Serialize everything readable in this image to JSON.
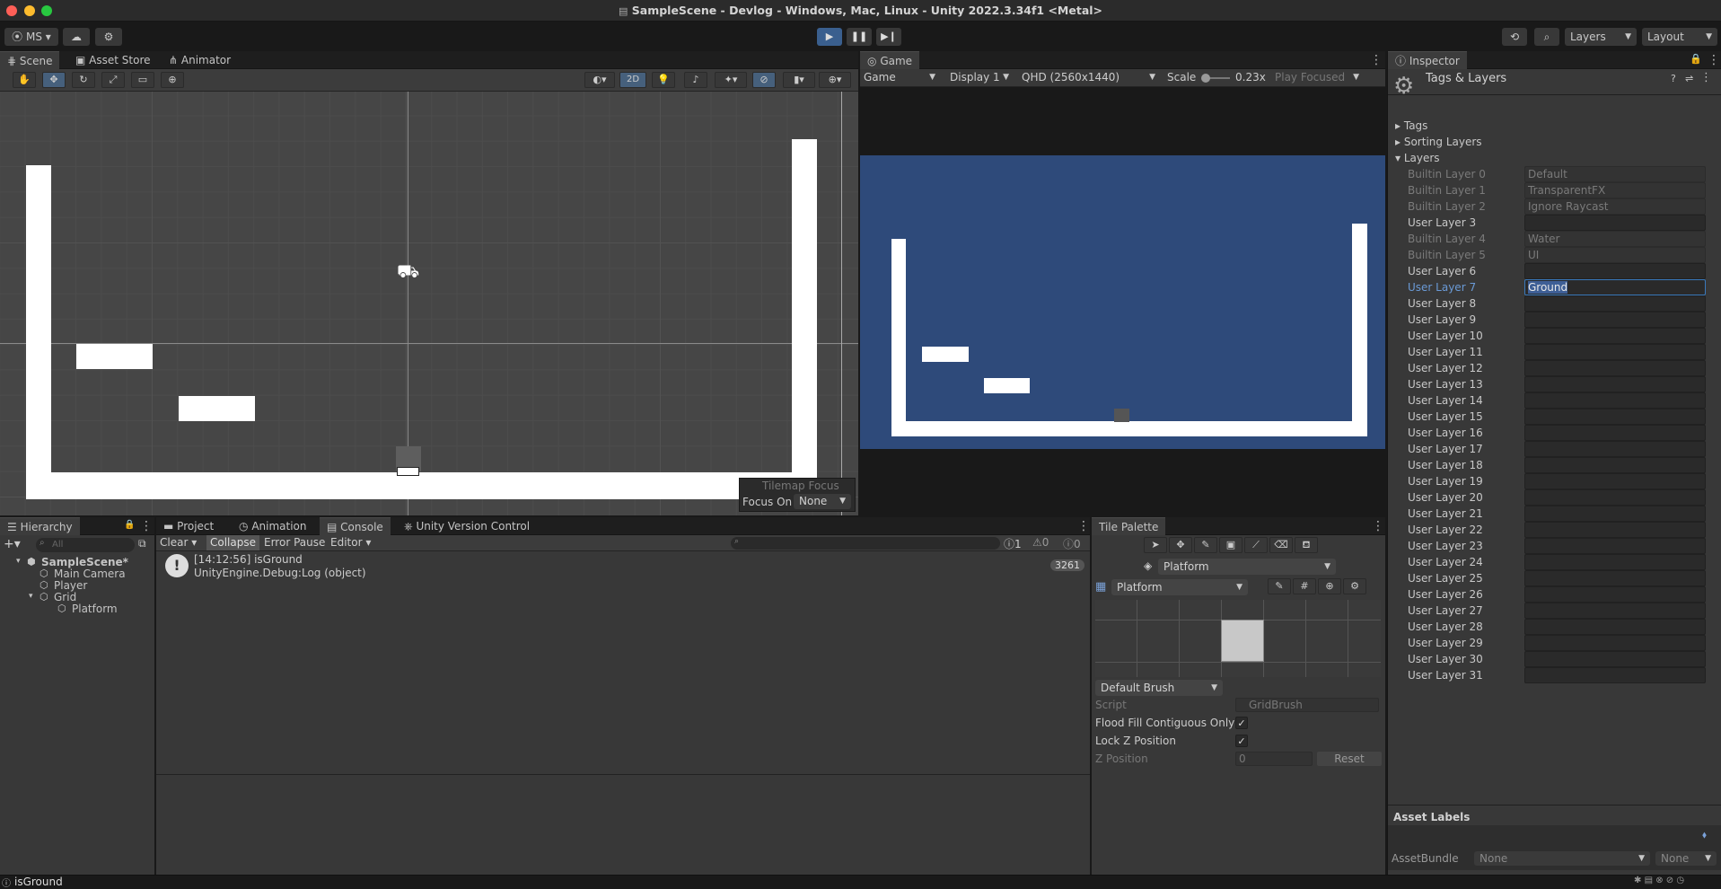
{
  "window": {
    "title": "SampleScene - Devlog - Windows, Mac, Linux - Unity 2022.3.34f1 <Metal>"
  },
  "toolbar": {
    "account": "MS",
    "layers_dropdown": "Layers",
    "layout_dropdown": "Layout"
  },
  "scene_tabs": [
    "Scene",
    "Asset Store",
    "Animator"
  ],
  "scene_toolbar": {
    "mode_2d": "2D"
  },
  "tilemap_focus": {
    "title": "Tilemap Focus",
    "label": "Focus On",
    "value": "None"
  },
  "game": {
    "tab": "Game",
    "view_dropdown": "Game",
    "display": "Display 1",
    "resolution": "QHD (2560x1440)",
    "scale_label": "Scale",
    "scale_value": "0.23x",
    "play_focused": "Play Focused",
    "background_color": "#2e4a7a"
  },
  "inspector": {
    "tab": "Inspector",
    "title": "Tags & Layers",
    "sections": [
      "Tags",
      "Sorting Layers",
      "Layers"
    ],
    "layers": [
      {
        "label": "Builtin Layer 0",
        "value": "Default",
        "builtin": true
      },
      {
        "label": "Builtin Layer 1",
        "value": "TransparentFX",
        "builtin": true
      },
      {
        "label": "Builtin Layer 2",
        "value": "Ignore Raycast",
        "builtin": true
      },
      {
        "label": "User Layer 3",
        "value": "",
        "builtin": false
      },
      {
        "label": "Builtin Layer 4",
        "value": "Water",
        "builtin": true
      },
      {
        "label": "Builtin Layer 5",
        "value": "UI",
        "builtin": true
      },
      {
        "label": "User Layer 6",
        "value": "",
        "builtin": false
      },
      {
        "label": "User Layer 7",
        "value": "Ground",
        "builtin": false,
        "selected": true
      },
      {
        "label": "User Layer 8",
        "value": "",
        "builtin": false
      },
      {
        "label": "User Layer 9",
        "value": "",
        "builtin": false
      },
      {
        "label": "User Layer 10",
        "value": "",
        "builtin": false
      },
      {
        "label": "User Layer 11",
        "value": "",
        "builtin": false
      },
      {
        "label": "User Layer 12",
        "value": "",
        "builtin": false
      },
      {
        "label": "User Layer 13",
        "value": "",
        "builtin": false
      },
      {
        "label": "User Layer 14",
        "value": "",
        "builtin": false
      },
      {
        "label": "User Layer 15",
        "value": "",
        "builtin": false
      },
      {
        "label": "User Layer 16",
        "value": "",
        "builtin": false
      },
      {
        "label": "User Layer 17",
        "value": "",
        "builtin": false
      },
      {
        "label": "User Layer 18",
        "value": "",
        "builtin": false
      },
      {
        "label": "User Layer 19",
        "value": "",
        "builtin": false
      },
      {
        "label": "User Layer 20",
        "value": "",
        "builtin": false
      },
      {
        "label": "User Layer 21",
        "value": "",
        "builtin": false
      },
      {
        "label": "User Layer 22",
        "value": "",
        "builtin": false
      },
      {
        "label": "User Layer 23",
        "value": "",
        "builtin": false
      },
      {
        "label": "User Layer 24",
        "value": "",
        "builtin": false
      },
      {
        "label": "User Layer 25",
        "value": "",
        "builtin": false
      },
      {
        "label": "User Layer 26",
        "value": "",
        "builtin": false
      },
      {
        "label": "User Layer 27",
        "value": "",
        "builtin": false
      },
      {
        "label": "User Layer 28",
        "value": "",
        "builtin": false
      },
      {
        "label": "User Layer 29",
        "value": "",
        "builtin": false
      },
      {
        "label": "User Layer 30",
        "value": "",
        "builtin": false
      },
      {
        "label": "User Layer 31",
        "value": "",
        "builtin": false
      }
    ],
    "asset_labels": "Asset Labels",
    "asset_bundle_label": "AssetBundle",
    "asset_bundle_value": "None",
    "asset_variant_value": "None"
  },
  "hierarchy": {
    "tab": "Hierarchy",
    "search_placeholder": "All",
    "items": [
      {
        "label": "SampleScene*",
        "depth": 0
      },
      {
        "label": "Main Camera",
        "depth": 1
      },
      {
        "label": "Player",
        "depth": 1
      },
      {
        "label": "Grid",
        "depth": 1
      },
      {
        "label": "Platform",
        "depth": 2
      }
    ]
  },
  "console": {
    "tabs": [
      "Project",
      "Animation",
      "Console",
      "Unity Version Control"
    ],
    "buttons": {
      "clear": "Clear",
      "collapse": "Collapse",
      "error_pause": "Error Pause",
      "editor": "Editor"
    },
    "counts": {
      "logs": "1",
      "warnings": "0",
      "errors": "0"
    },
    "entry": {
      "line1": "[14:12:56] isGround",
      "line2": "UnityEngine.Debug:Log (object)",
      "count": "3261"
    }
  },
  "tile_palette": {
    "tab": "Tile Palette",
    "target": "Platform",
    "palette": "Platform",
    "brush": "Default Brush",
    "script_label": "Script",
    "script_value": "GridBrush",
    "flood_fill": "Flood Fill Contiguous Only",
    "lock_z": "Lock Z Position",
    "z_label": "Z Position",
    "z_value": "0",
    "reset": "Reset"
  },
  "status": {
    "message": "isGround"
  }
}
